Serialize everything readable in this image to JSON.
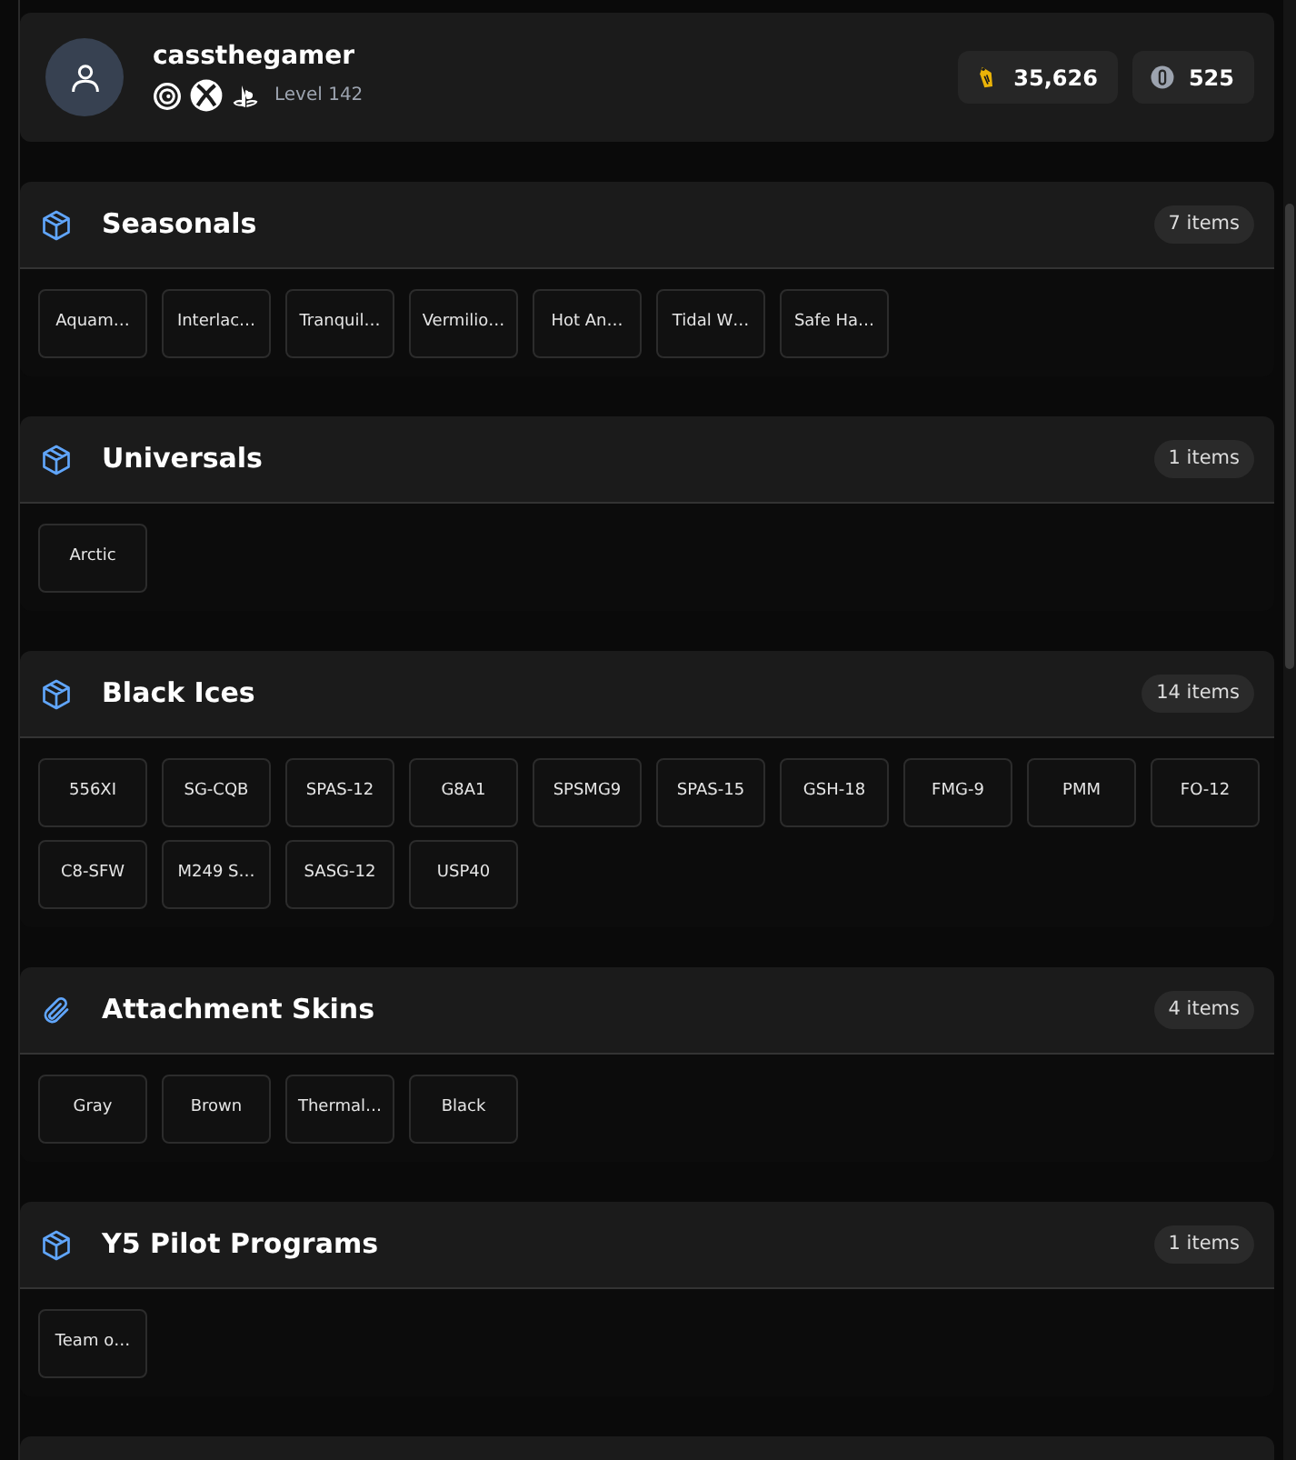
{
  "profile": {
    "username": "cassthegamer",
    "level": "Level 142",
    "platforms": [
      {
        "kind": "ubisoft"
      },
      {
        "kind": "xbox"
      },
      {
        "kind": "playstation"
      }
    ]
  },
  "currencies": [
    {
      "kind": "credits",
      "amount": "35,626"
    },
    {
      "kind": "renown",
      "amount": "525"
    }
  ],
  "sections": [
    {
      "title": "Seasonals",
      "kind": "box",
      "count": "7 items",
      "items": [
        "Aquam…",
        "Interlac…",
        "Tranquil…",
        "Vermilio…",
        "Hot An…",
        "Tidal W…",
        "Safe Ha…"
      ]
    },
    {
      "title": "Universals",
      "kind": "box",
      "count": "1 items",
      "items": [
        "Arctic"
      ]
    },
    {
      "title": "Black Ices",
      "kind": "box",
      "count": "14 items",
      "items": [
        "556XI",
        "SG-CQB",
        "SPAS-12",
        "G8A1",
        "SPSMG9",
        "SPAS-15",
        "GSH-18",
        "FMG-9",
        "PMM",
        "FO-12",
        "C8-SFW",
        "M249 S…",
        "SASG-12",
        "USP40"
      ]
    },
    {
      "title": "Attachment Skins",
      "kind": "clip",
      "count": "4 items",
      "items": [
        "Gray",
        "Brown",
        "Thermal…",
        "Black"
      ]
    },
    {
      "title": "Y5 Pilot Programs",
      "kind": "box",
      "count": "1 items",
      "items": [
        "Team o…"
      ]
    }
  ]
}
